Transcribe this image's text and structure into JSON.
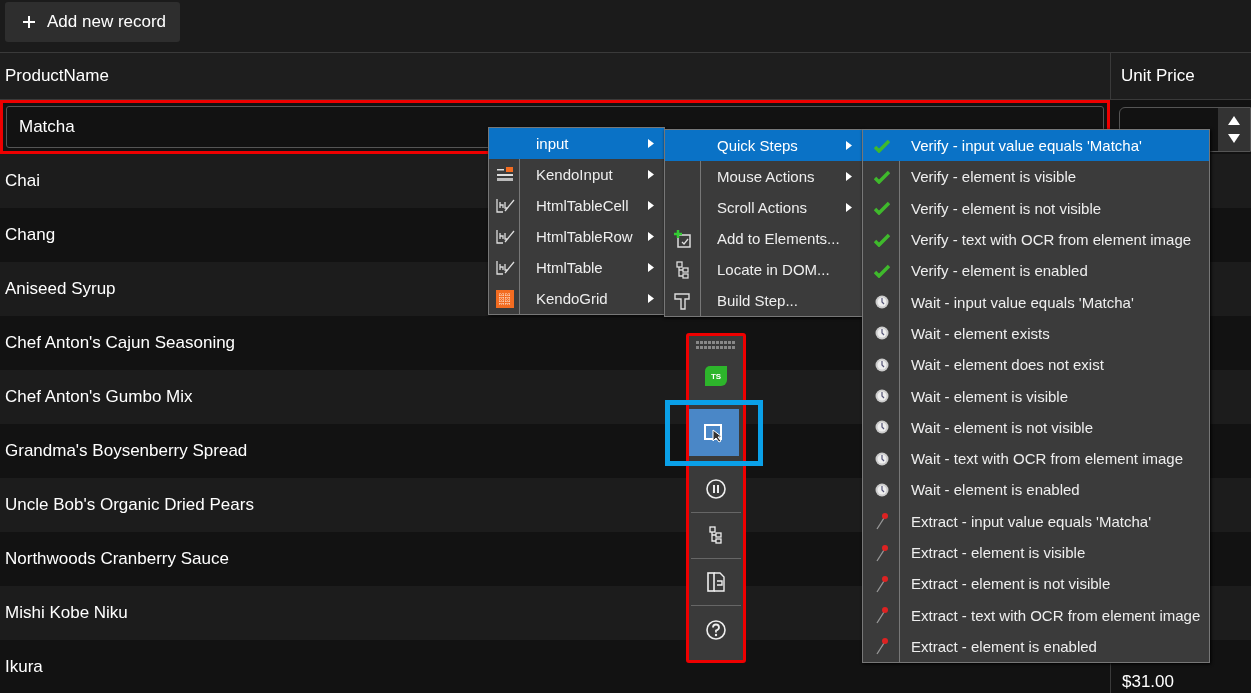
{
  "toolbar": {
    "add_button": "Add new record"
  },
  "grid": {
    "columns": [
      "ProductName",
      "Unit Price"
    ],
    "edit_row": {
      "product_name": "Matcha"
    },
    "rows": [
      {
        "product_name": "Chai"
      },
      {
        "product_name": "Chang"
      },
      {
        "product_name": "Aniseed Syrup"
      },
      {
        "product_name": "Chef Anton's Cajun Seasoning"
      },
      {
        "product_name": "Chef Anton's Gumbo Mix"
      },
      {
        "product_name": "Grandma's Boysenberry Spread"
      },
      {
        "product_name": "Uncle Bob's Organic Dried Pears"
      },
      {
        "product_name": "Northwoods Cranberry Sauce"
      },
      {
        "product_name": "Mishi Kobe Niku"
      },
      {
        "product_name": "Ikura",
        "unit_price": "$31.00"
      }
    ]
  },
  "element_menu": [
    {
      "label": "input",
      "kind": "none",
      "selected": true
    },
    {
      "label": "KendoInput",
      "kind": "kendo-input",
      "selected": false
    },
    {
      "label": "HtmlTableCell",
      "kind": "html-element",
      "selected": false
    },
    {
      "label": "HtmlTableRow",
      "kind": "html-element",
      "selected": false
    },
    {
      "label": "HtmlTable",
      "kind": "html-element",
      "selected": false
    },
    {
      "label": "KendoGrid",
      "kind": "kendo-grid",
      "selected": false
    }
  ],
  "action_menu": [
    {
      "label": "Quick Steps",
      "kind": "none",
      "submenu": true,
      "selected": true
    },
    {
      "label": "Mouse Actions",
      "kind": "none",
      "submenu": true,
      "selected": false
    },
    {
      "label": "Scroll Actions",
      "kind": "none",
      "submenu": true,
      "selected": false
    },
    {
      "label": "Add to Elements...",
      "kind": "add",
      "submenu": false,
      "selected": false
    },
    {
      "label": "Locate in DOM...",
      "kind": "tree",
      "submenu": false,
      "selected": false
    },
    {
      "label": "Build Step...",
      "kind": "build",
      "submenu": false,
      "selected": false
    }
  ],
  "step_menu": [
    {
      "label": "Verify - input value equals 'Matcha'",
      "kind": "verify",
      "selected": true
    },
    {
      "label": "Verify - element is visible",
      "kind": "verify",
      "selected": false
    },
    {
      "label": "Verify - element is not visible",
      "kind": "verify",
      "selected": false
    },
    {
      "label": "Verify - text with OCR from element image",
      "kind": "verify",
      "selected": false
    },
    {
      "label": "Verify - element is enabled",
      "kind": "verify",
      "selected": false
    },
    {
      "label": "Wait - input value equals 'Matcha'",
      "kind": "wait",
      "selected": false
    },
    {
      "label": "Wait - element exists",
      "kind": "wait",
      "selected": false
    },
    {
      "label": "Wait - element does not exist",
      "kind": "wait",
      "selected": false
    },
    {
      "label": "Wait - element is visible",
      "kind": "wait",
      "selected": false
    },
    {
      "label": "Wait - element is not visible",
      "kind": "wait",
      "selected": false
    },
    {
      "label": "Wait - text with OCR from element image",
      "kind": "wait",
      "selected": false
    },
    {
      "label": "Wait - element is enabled",
      "kind": "wait",
      "selected": false
    },
    {
      "label": "Extract - input value equals 'Matcha'",
      "kind": "extract",
      "selected": false
    },
    {
      "label": "Extract - element is visible",
      "kind": "extract",
      "selected": false
    },
    {
      "label": "Extract - element is not visible",
      "kind": "extract",
      "selected": false
    },
    {
      "label": "Extract - text with OCR from element image",
      "kind": "extract",
      "selected": false
    },
    {
      "label": "Extract - element is enabled",
      "kind": "extract",
      "selected": false
    }
  ],
  "recorder_bar": [
    {
      "kind": "ts",
      "label": "TS",
      "selected": false
    },
    {
      "kind": "highlight",
      "selected": true
    },
    {
      "kind": "pause",
      "selected": false
    },
    {
      "kind": "tree",
      "selected": false
    },
    {
      "kind": "panel",
      "selected": false
    },
    {
      "kind": "help",
      "selected": false
    }
  ]
}
